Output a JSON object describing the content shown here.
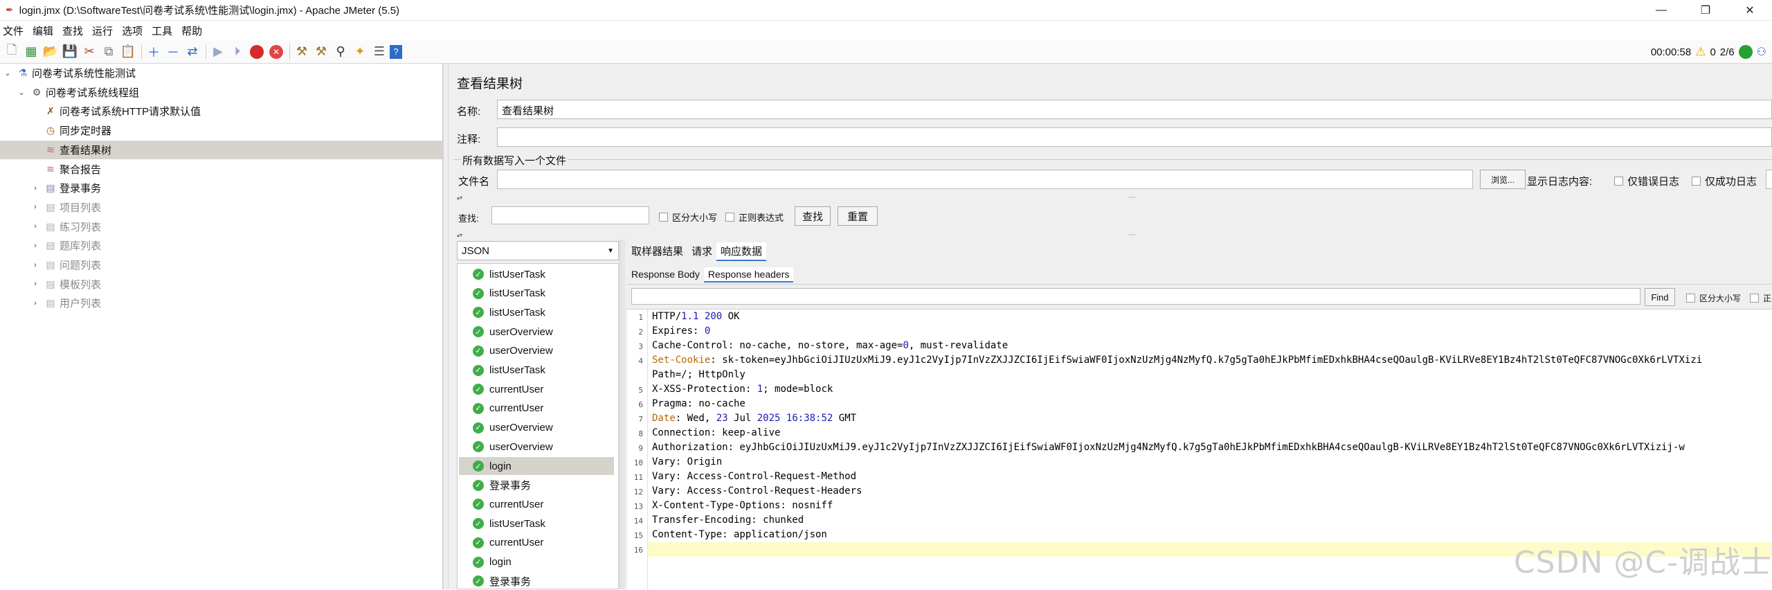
{
  "window": {
    "title": "login.jmx (D:\\SoftwareTest\\问卷考试系统\\性能测试\\login.jmx) - Apache JMeter (5.5)",
    "minimize": "—",
    "maximize": "❐",
    "close": "✕"
  },
  "menu": [
    "文件",
    "编辑",
    "查找",
    "运行",
    "选项",
    "工具",
    "帮助"
  ],
  "status": {
    "timer": "00:00:58",
    "warnings": "0",
    "threads": "2/6"
  },
  "tree": [
    {
      "label": "问卷考试系统性能测试",
      "level": 0,
      "toggle": "⌄",
      "icon": "flask-icon"
    },
    {
      "label": "问卷考试系统线程组",
      "level": 1,
      "toggle": "⌄",
      "icon": "gear-icon"
    },
    {
      "label": "问卷考试系统HTTP请求默认值",
      "level": 2,
      "toggle": "",
      "icon": "wrench-icon"
    },
    {
      "label": "同步定时器",
      "level": 2,
      "toggle": "",
      "icon": "timer-icon"
    },
    {
      "label": "查看结果树",
      "level": 2,
      "toggle": "",
      "icon": "listener-icon",
      "selected": true
    },
    {
      "label": "聚合报告",
      "level": 2,
      "toggle": "",
      "icon": "listener-icon"
    },
    {
      "label": "登录事务",
      "level": 2,
      "toggle": "›",
      "icon": "controller-icon"
    },
    {
      "label": "项目列表",
      "level": 2,
      "toggle": "›",
      "icon": "controller-icon",
      "disabled": true
    },
    {
      "label": "练习列表",
      "level": 2,
      "toggle": "›",
      "icon": "controller-icon",
      "disabled": true
    },
    {
      "label": "题库列表",
      "level": 2,
      "toggle": "›",
      "icon": "controller-icon",
      "disabled": true
    },
    {
      "label": "问题列表",
      "level": 2,
      "toggle": "›",
      "icon": "controller-icon",
      "disabled": true
    },
    {
      "label": "模板列表",
      "level": 2,
      "toggle": "›",
      "icon": "controller-icon",
      "disabled": true
    },
    {
      "label": "用户列表",
      "level": 2,
      "toggle": "›",
      "icon": "controller-icon",
      "disabled": true
    }
  ],
  "panel": {
    "title": "查看结果树",
    "name_label": "名称:",
    "name_value": "查看结果树",
    "comment_label": "注释:",
    "comment_value": "",
    "file_group": "所有数据写入一个文件",
    "filename_label": "文件名",
    "filename_value": "",
    "browse": "浏览...",
    "log_label": "显示日志内容:",
    "errors_only": "仅错误日志",
    "success_only": "仅成功日志",
    "search_label": "查找:",
    "case_sensitive": "区分大小写",
    "regex": "正则表达式",
    "find_btn": "查找",
    "reset_btn": "重置"
  },
  "renderer": "JSON",
  "results": [
    "listUserTask",
    "listUserTask",
    "listUserTask",
    "userOverview",
    "userOverview",
    "listUserTask",
    "currentUser",
    "currentUser",
    "userOverview",
    "userOverview",
    "login",
    "登录事务",
    "currentUser",
    "listUserTask",
    "currentUser",
    "login",
    "登录事务"
  ],
  "result_selected_index": 10,
  "tabs_main": [
    "取样器结果",
    "请求",
    "响应数据"
  ],
  "tabs_sub": [
    "Response Body",
    "Response headers"
  ],
  "find": {
    "button": "Find",
    "case": "区分大小写",
    "regex": "正"
  },
  "headers": [
    "HTTP/1.1 200 OK",
    "Expires: 0",
    "Cache-Control: no-cache, no-store, max-age=0, must-revalidate",
    "Set-Cookie: sk-token=eyJhbGciOiJIUzUxMiJ9.eyJ1c2VyIjp7InVzZXJJZCI6IjEifSwiaWF0IjoxNzUzMjg4NzMyfQ.k7g5gTa0hEJkPbMfimEDxhkBHA4cseQOaulgB-KViLRVe8EY1Bz4hT2lSt0TeQFC87VNOGc0Xk6rLVTXizi",
    "Path=/; HttpOnly",
    "X-XSS-Protection: 1; mode=block",
    "Pragma: no-cache",
    "Date: Wed, 23 Jul 2025 16:38:52 GMT",
    "Connection: keep-alive",
    "Authorization: eyJhbGciOiJIUzUxMiJ9.eyJ1c2VyIjp7InVzZXJJZCI6IjEifSwiaWF0IjoxNzUzMjg4NzMyfQ.k7g5gTa0hEJkPbMfimEDxhkBHA4cseQOaulgB-KViLRVe8EY1Bz4hT2lSt0TeQFC87VNOGc0Xk6rLVTXizij-w",
    "Vary: Origin",
    "Vary: Access-Control-Request-Method",
    "Vary: Access-Control-Request-Headers",
    "X-Content-Type-Options: nosniff",
    "Transfer-Encoding: chunked",
    "Content-Type: application/json",
    ""
  ],
  "line_numbers": [
    "1",
    "2",
    "3",
    "4",
    "",
    "5",
    "6",
    "7",
    "8",
    "9",
    "10",
    "11",
    "12",
    "13",
    "14",
    "15",
    "16"
  ],
  "watermark": "CSDN @C-调战士"
}
